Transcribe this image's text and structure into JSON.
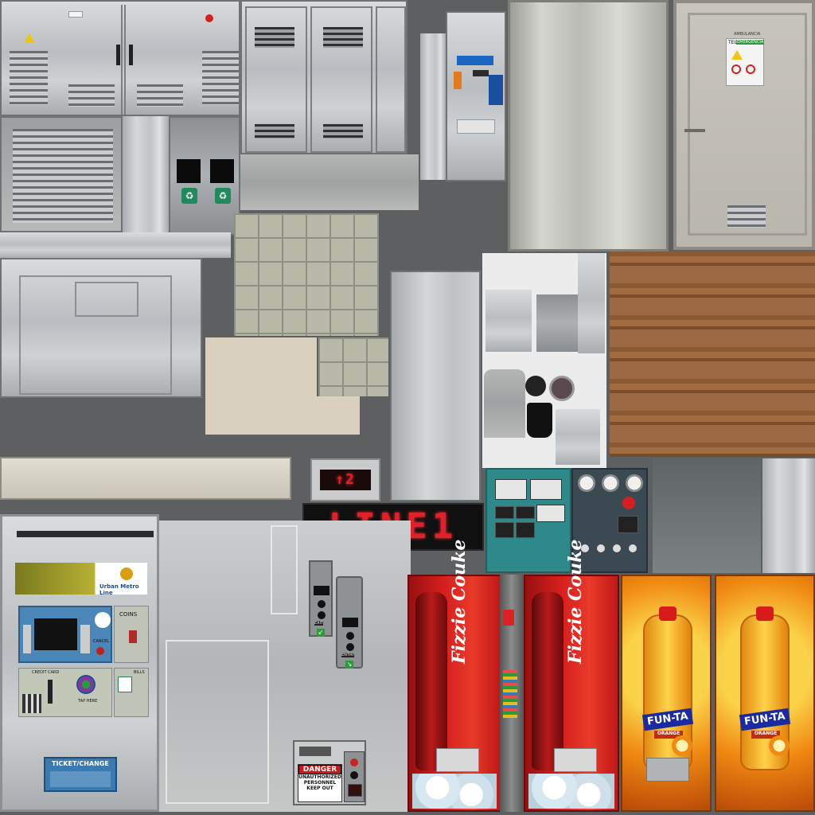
{
  "atlas": {
    "background": "#5d5f60"
  },
  "fare_machine": {
    "brand_name": "Urban Metro Line",
    "coins_label": "COINS",
    "cancel_label": "CANCEL",
    "credit_card_label": "CREDIT CARD",
    "tap_here_label": "TAP HERE",
    "bills_label": "BILLS",
    "ticket_change_label": "TICKET/CHANGE",
    "accent_color": "#4a86b8"
  },
  "displays": {
    "platform_sign": "↑2",
    "line_sign": "LINE1",
    "led_color": "#e0202a"
  },
  "turnstile": {
    "exit_label": "EXIT",
    "entry_label": "ENTRY"
  },
  "danger_sign": {
    "title": "DANGER",
    "line1": "UNAUTHORIZED",
    "line2": "PERSONNEL",
    "line3": "KEEP OUT"
  },
  "vending": {
    "cola_brand": "Fizzie Couke",
    "cola_color": "#d8201e",
    "orange_brand": "FUN-TA",
    "orange_flavor": "ORANGE",
    "orange_color": "#f08a12"
  },
  "electrical_cabinet": {
    "notice_top": "TEL",
    "notice_green": "EMERGENCIA",
    "notice_sub": "AMBULANCIA"
  },
  "icons": [
    "warning-triangle-icon",
    "no-entry-icon",
    "recycle-icon",
    "arrow-down-left-icon",
    "arrow-down-right-icon",
    "coin-icon",
    "card-icon"
  ]
}
